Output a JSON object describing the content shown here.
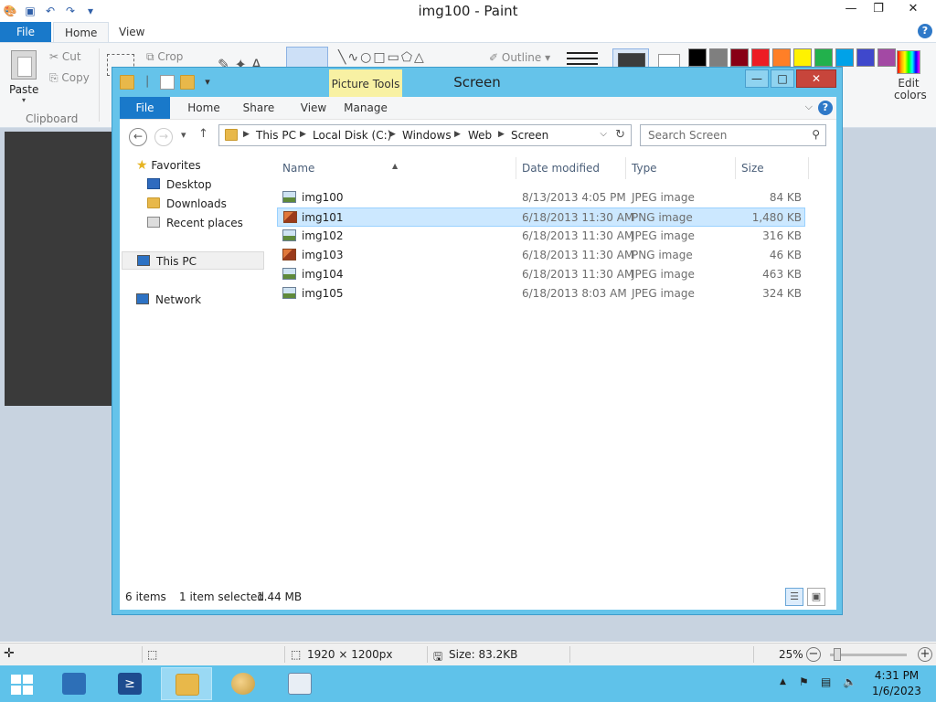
{
  "paint": {
    "title": "img100 - Paint",
    "tabs": {
      "file": "File",
      "home": "Home",
      "view": "View"
    },
    "ribbon": {
      "paste": "Paste",
      "cut": "Cut",
      "copy": "Copy",
      "crop": "Crop",
      "clipboard_group": "Clipboard",
      "outline": "Outline",
      "edit_colors": "Edit colors",
      "palette": [
        "#000000",
        "#7f7f7f",
        "#880015",
        "#ed1c24",
        "#ff7f27",
        "#fff200",
        "#22b14c",
        "#00a2e8",
        "#3f48cc",
        "#a349a4"
      ]
    },
    "status": {
      "dimensions": "1920 × 1200px",
      "size": "Size: 83.2KB",
      "zoom": "25%"
    }
  },
  "explorer": {
    "title": "Screen",
    "context_tab": "Picture Tools",
    "tabs": {
      "file": "File",
      "home": "Home",
      "share": "Share",
      "view": "View",
      "manage": "Manage"
    },
    "address": {
      "segments": [
        "This PC",
        "Local Disk (C:)",
        "Windows",
        "Web",
        "Screen"
      ]
    },
    "search_placeholder": "Search Screen",
    "nav": {
      "favorites": "Favorites",
      "desktop": "Desktop",
      "downloads": "Downloads",
      "recent": "Recent places",
      "thispc": "This PC",
      "network": "Network"
    },
    "columns": {
      "name": "Name",
      "date": "Date modified",
      "type": "Type",
      "size": "Size"
    },
    "files": [
      {
        "name": "img100",
        "date": "8/13/2013 4:05 PM",
        "type": "JPEG image",
        "size": "84 KB"
      },
      {
        "name": "img101",
        "date": "6/18/2013 11:30 AM",
        "type": "PNG image",
        "size": "1,480 KB"
      },
      {
        "name": "img102",
        "date": "6/18/2013 11:30 AM",
        "type": "JPEG image",
        "size": "316 KB"
      },
      {
        "name": "img103",
        "date": "6/18/2013 11:30 AM",
        "type": "PNG image",
        "size": "46 KB"
      },
      {
        "name": "img104",
        "date": "6/18/2013 11:30 AM",
        "type": "JPEG image",
        "size": "463 KB"
      },
      {
        "name": "img105",
        "date": "6/18/2013 8:03 AM",
        "type": "JPEG image",
        "size": "324 KB"
      }
    ],
    "status": {
      "items": "6 items",
      "selected": "1 item selected",
      "selected_size": "1.44 MB"
    }
  },
  "taskbar": {
    "time": "4:31 PM",
    "date": "1/6/2023"
  }
}
